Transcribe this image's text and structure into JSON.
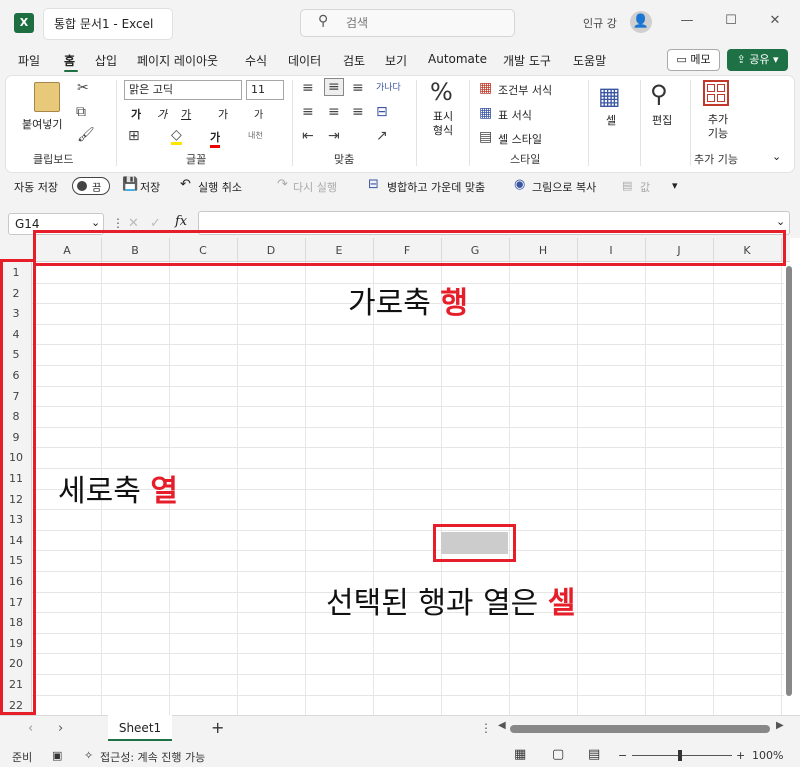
{
  "app": {
    "logo_letter": "X",
    "window_title": "통합 문서1 - Excel",
    "search_placeholder": "검색",
    "user_name": "인규 강",
    "avatar_glyph": "👤"
  },
  "menu": {
    "items": [
      "파일",
      "홈",
      "삽입",
      "페이지 레이아웃",
      "수식",
      "데이터",
      "검토",
      "보기",
      "Automate",
      "개발 도구",
      "도움말"
    ],
    "memo_label": "메모",
    "share_label": "공유"
  },
  "ribbon": {
    "groups": [
      "클립보드",
      "글꼴",
      "맞춤",
      "스타일",
      "",
      "",
      "추가 기능"
    ],
    "paste_label": "붙여넣기",
    "font_name": "맑은 고딕",
    "font_size": "11",
    "bold": "가",
    "italic": "가",
    "underline": "가",
    "grow_font": "가",
    "shrink_font": "가",
    "font_color_glyph": "가",
    "phonetic": "내천",
    "wrap_text": "가나다",
    "number_format_icon": "%",
    "number_format_label": "표시 형식",
    "conditional_format": "조건부 서식",
    "format_as_table": "표 서식",
    "cell_styles": "셀 스타일",
    "cells_label": "셀",
    "editing_label": "편집",
    "addins_label": "추가 기능"
  },
  "qat": {
    "autosave_label": "자동 저장",
    "autosave_state": "끔",
    "save_label": "저장",
    "undo_label": "실행 취소",
    "redo_label": "다시 실행",
    "merge_label": "병합하고 가운데 맞춤",
    "copy_picture_label": "그림으로 복사",
    "value_label": "값"
  },
  "formula_bar": {
    "name_box": "G14",
    "fx": "fx",
    "cancel": "✕",
    "enter": "✓"
  },
  "sheet": {
    "columns": [
      "A",
      "B",
      "C",
      "D",
      "E",
      "F",
      "G",
      "H",
      "I",
      "J",
      "K"
    ],
    "rows": [
      "1",
      "2",
      "3",
      "4",
      "5",
      "6",
      "7",
      "8",
      "9",
      "10",
      "11",
      "12",
      "13",
      "14",
      "15",
      "16",
      "17",
      "18",
      "19",
      "20",
      "21",
      "22"
    ],
    "selected_cell": "G14"
  },
  "annotations": {
    "row_axis_prefix": "가로축 ",
    "row_axis_emph": "행",
    "col_axis_prefix": "세로축 ",
    "col_axis_emph": "열",
    "cell_prefix": "선택된 행과 열은 ",
    "cell_emph": "셀",
    "accent_color": "#e61e2a"
  },
  "tabs": {
    "sheet_name": "Sheet1",
    "add": "+"
  },
  "status": {
    "ready": "준비",
    "accessibility": "접근성: 계속 진행 가능",
    "zoom": "100%"
  }
}
